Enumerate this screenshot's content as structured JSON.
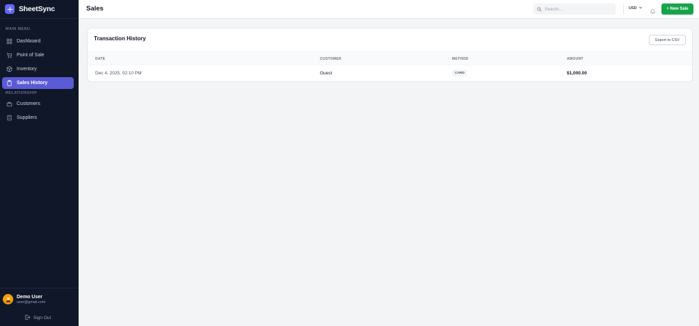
{
  "app": {
    "name": "SheetSync"
  },
  "sidebar": {
    "main_menu_label": "MAIN MENU",
    "relationship_label": "RELATIONSHIP",
    "main_items": [
      {
        "label": "Dashboard",
        "icon": "dashboard-icon"
      },
      {
        "label": "Point of Sale",
        "icon": "cart-icon"
      },
      {
        "label": "Inventory",
        "icon": "box-icon"
      },
      {
        "label": "Sales History",
        "icon": "clipboard-icon",
        "active": true
      }
    ],
    "relationship_items": [
      {
        "label": "Customers",
        "icon": "users-icon"
      },
      {
        "label": "Suppliers",
        "icon": "building-icon"
      }
    ],
    "user": {
      "name": "Demo User",
      "email": "user@gmail.com"
    },
    "signout_label": "Sign Out"
  },
  "header": {
    "title": "Sales",
    "search_placeholder": "Search...",
    "currency": "USD",
    "new_sale_label": "+ New Sale"
  },
  "transactions": {
    "title": "Transaction History",
    "export_label": "Export to CSV",
    "columns": [
      "DATE",
      "CUSTOMER",
      "METHOD",
      "AMOUNT"
    ],
    "rows": [
      {
        "date": "Dec 4, 2025, 02:10 PM",
        "customer": "Guest",
        "method": "CARD",
        "amount": "$1,000.00"
      }
    ]
  },
  "colors": {
    "sidebar_bg": "#0f1729",
    "active_item": "#5b5bd6",
    "primary_green": "#16a34a",
    "brand_accent": "#6366f1"
  }
}
